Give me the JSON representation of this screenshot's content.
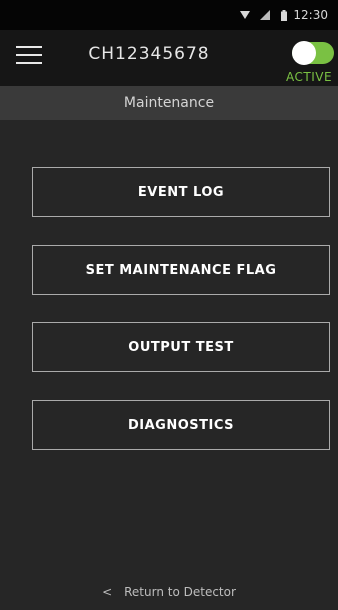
{
  "status_bar": {
    "time": "12:30",
    "icons": [
      "wifi-icon",
      "cell-signal-icon",
      "battery-icon"
    ]
  },
  "header": {
    "menu_icon": "hamburger-menu-icon",
    "device_id": "CH12345678",
    "toggle_label": "ACTIVE",
    "toggle_on": true
  },
  "subheader": {
    "title": "Maintenance"
  },
  "menu": {
    "items": [
      {
        "label": "EVENT LOG"
      },
      {
        "label": "SET MAINTENANCE FLAG"
      },
      {
        "label": "OUTPUT TEST"
      },
      {
        "label": "DIAGNOSTICS"
      }
    ]
  },
  "footer": {
    "back_icon": "chevron-left-icon",
    "back_chevron": "<",
    "back_label": "Return to Detector"
  },
  "colors": {
    "background": "#262626",
    "header_bg": "#161616",
    "subheader_bg": "#3a3a3a",
    "accent_green": "#7ac143",
    "button_border": "#aaaaaa"
  }
}
